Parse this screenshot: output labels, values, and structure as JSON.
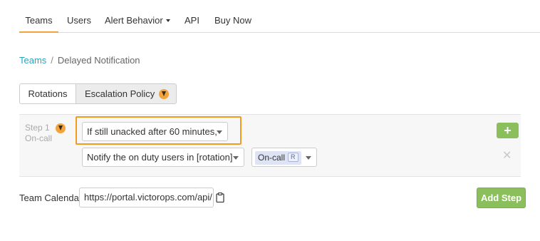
{
  "nav": {
    "teams": "Teams",
    "users": "Users",
    "alert_behavior": "Alert Behavior",
    "api": "API",
    "buy_now": "Buy Now",
    "accent_color": "#f3a33c"
  },
  "breadcrumb": {
    "teams": "Teams",
    "separator": "/",
    "current": "Delayed Notification"
  },
  "subtabs": {
    "rotations": "Rotations",
    "escalation_policy": "Escalation Policy"
  },
  "step": {
    "title": "Step 1",
    "subtitle": "On-call",
    "condition_select": "If still unacked after 60 minutes,",
    "notify_select": "Notify the on duty users in [rotation]",
    "rotation_tag": "On-call",
    "rotation_tag_badge": "R",
    "add_icon": "plus-icon",
    "remove_icon": "close-icon",
    "highlight_color": "#f39a21"
  },
  "calendar": {
    "label": "Team Calendar",
    "url": "https://portal.victorops.com/api/",
    "icon": "clipboard-icon"
  },
  "actions": {
    "add_step": "Add Step",
    "button_color": "#8bbf5c"
  }
}
